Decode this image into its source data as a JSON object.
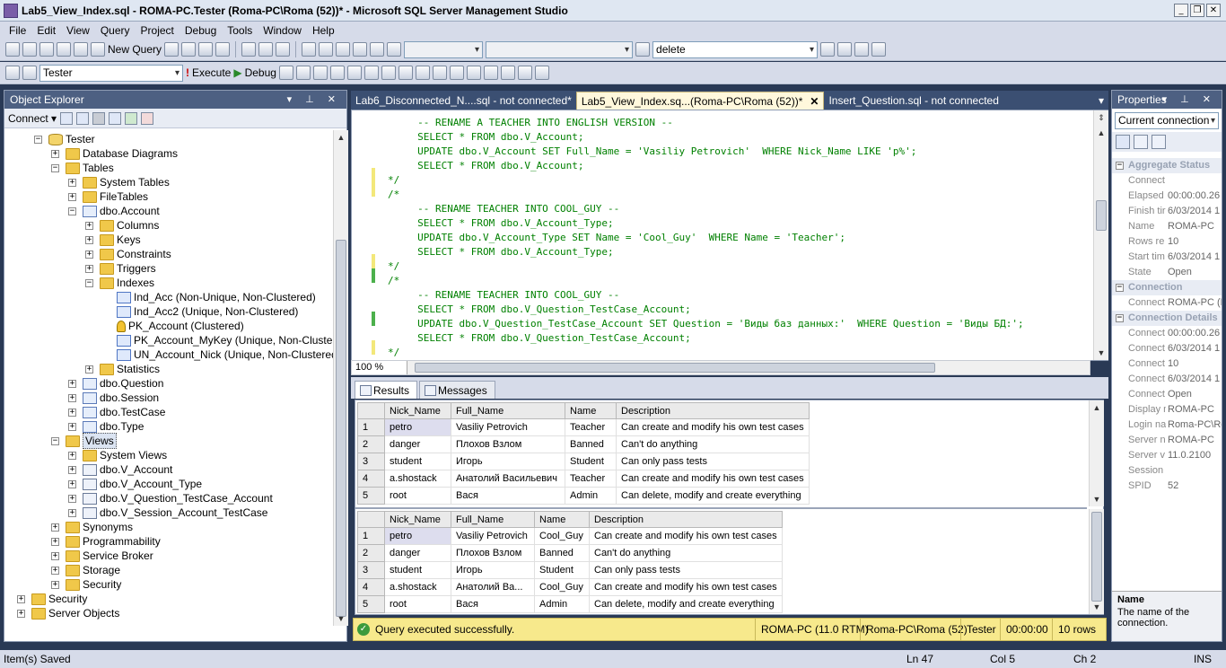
{
  "window": {
    "title": "Lab5_View_Index.sql - ROMA-PC.Tester (Roma-PC\\Roma (52))* - Microsoft SQL Server Management Studio",
    "buttons": [
      "_",
      "❐",
      "✕"
    ]
  },
  "menu": [
    "File",
    "Edit",
    "View",
    "Query",
    "Project",
    "Debug",
    "Tools",
    "Window",
    "Help"
  ],
  "toolbar1": {
    "new_query": "New Query",
    "search_combo": "delete"
  },
  "toolbar2": {
    "database": "Tester",
    "execute": "Execute",
    "debug": "Debug"
  },
  "object_explorer": {
    "title": "Object Explorer",
    "pin": "▾ ⊥ ✕",
    "connect": "Connect ▾",
    "tree": [
      {
        "label": "Tester",
        "icon": "database-icon",
        "depth": 2,
        "exp": "−"
      },
      {
        "label": "Database Diagrams",
        "icon": "folder-icon",
        "depth": 3,
        "exp": "+"
      },
      {
        "label": "Tables",
        "icon": "folder-icon",
        "depth": 3,
        "exp": "−"
      },
      {
        "label": "System Tables",
        "icon": "folder-icon",
        "depth": 4,
        "exp": "+"
      },
      {
        "label": "FileTables",
        "icon": "folder-icon",
        "depth": 4,
        "exp": "+"
      },
      {
        "label": "dbo.Account",
        "icon": "table-icon",
        "depth": 4,
        "exp": "−"
      },
      {
        "label": "Columns",
        "icon": "folder-icon",
        "depth": 5,
        "exp": "+"
      },
      {
        "label": "Keys",
        "icon": "folder-icon",
        "depth": 5,
        "exp": "+"
      },
      {
        "label": "Constraints",
        "icon": "folder-icon",
        "depth": 5,
        "exp": "+"
      },
      {
        "label": "Triggers",
        "icon": "folder-icon",
        "depth": 5,
        "exp": "+"
      },
      {
        "label": "Indexes",
        "icon": "folder-icon",
        "depth": 5,
        "exp": "−"
      },
      {
        "label": "Ind_Acc (Non-Unique, Non-Clustered)",
        "icon": "index-icon",
        "depth": 6,
        "exp": ""
      },
      {
        "label": "Ind_Acc2 (Unique, Non-Clustered)",
        "icon": "index-icon",
        "depth": 6,
        "exp": ""
      },
      {
        "label": "PK_Account (Clustered)",
        "icon": "primary-key-icon",
        "depth": 6,
        "exp": ""
      },
      {
        "label": "PK_Account_MyKey (Unique, Non-Clustere",
        "icon": "index-icon",
        "depth": 6,
        "exp": ""
      },
      {
        "label": "UN_Account_Nick (Unique, Non-Clustered)",
        "icon": "unique-index-icon",
        "depth": 6,
        "exp": ""
      },
      {
        "label": "Statistics",
        "icon": "folder-icon",
        "depth": 5,
        "exp": "+"
      },
      {
        "label": "dbo.Question",
        "icon": "table-icon",
        "depth": 4,
        "exp": "+"
      },
      {
        "label": "dbo.Session",
        "icon": "table-icon",
        "depth": 4,
        "exp": "+"
      },
      {
        "label": "dbo.TestCase",
        "icon": "table-icon",
        "depth": 4,
        "exp": "+"
      },
      {
        "label": "dbo.Type",
        "icon": "table-icon",
        "depth": 4,
        "exp": "+"
      },
      {
        "label": "Views",
        "icon": "folder-icon",
        "depth": 3,
        "exp": "−",
        "selected": true
      },
      {
        "label": "System Views",
        "icon": "folder-icon",
        "depth": 4,
        "exp": "+"
      },
      {
        "label": "dbo.V_Account",
        "icon": "view-icon",
        "depth": 4,
        "exp": "+"
      },
      {
        "label": "dbo.V_Account_Type",
        "icon": "view-icon",
        "depth": 4,
        "exp": "+"
      },
      {
        "label": "dbo.V_Question_TestCase_Account",
        "icon": "view-icon",
        "depth": 4,
        "exp": "+"
      },
      {
        "label": "dbo.V_Session_Account_TestCase",
        "icon": "view-icon",
        "depth": 4,
        "exp": "+"
      },
      {
        "label": "Synonyms",
        "icon": "folder-icon",
        "depth": 3,
        "exp": "+"
      },
      {
        "label": "Programmability",
        "icon": "folder-icon",
        "depth": 3,
        "exp": "+"
      },
      {
        "label": "Service Broker",
        "icon": "folder-icon",
        "depth": 3,
        "exp": "+"
      },
      {
        "label": "Storage",
        "icon": "folder-icon",
        "depth": 3,
        "exp": "+"
      },
      {
        "label": "Security",
        "icon": "folder-icon",
        "depth": 3,
        "exp": "+"
      },
      {
        "label": "Security",
        "icon": "folder-icon",
        "depth": 1,
        "exp": "+"
      },
      {
        "label": "Server Objects",
        "icon": "folder-icon",
        "depth": 1,
        "exp": "+"
      }
    ]
  },
  "doc_tabs": [
    {
      "label": "Lab6_Disconnected_N....sql - not connected*",
      "active": false
    },
    {
      "label": "Lab5_View_Index.sq...(Roma-PC\\Roma (52))*",
      "active": true,
      "close": "✕"
    },
    {
      "label": "Insert_Question.sql - not connected",
      "active": false
    }
  ],
  "editor": {
    "zoom": "100 %",
    "lines": [
      "     -- RENAME A TEACHER INTO ENGLISH VERSION --",
      "     SELECT * FROM dbo.V_Account;",
      "     UPDATE dbo.V_Account SET Full_Name = 'Vasiliy Petrovich'  WHERE Nick_Name LIKE 'p%';",
      "     SELECT * FROM dbo.V_Account;",
      "*/",
      "/*",
      "     -- RENAME TEACHER INTO COOL_GUY --",
      "     SELECT * FROM dbo.V_Account_Type;",
      "     UPDATE dbo.V_Account_Type SET Name = 'Cool_Guy'  WHERE Name = 'Teacher';",
      "     SELECT * FROM dbo.V_Account_Type;",
      "*/",
      "/*",
      "     -- RENAME TEACHER INTO COOL_GUY --",
      "     SELECT * FROM dbo.V_Question_TestCase_Account;",
      "     UPDATE dbo.V_Question_TestCase_Account SET Question = 'Виды баз данных:'  WHERE Question = 'Виды БД:';",
      "     SELECT * FROM dbo.V_Question_TestCase_Account;",
      "*/"
    ]
  },
  "result_tabs": [
    "Results",
    "Messages"
  ],
  "grid1": {
    "columns": [
      "Nick_Name",
      "Full_Name",
      "Name",
      "Description"
    ],
    "rows": [
      [
        "1",
        "petro",
        "Vasiliy Petrovich",
        "Teacher",
        "Can create and modify his own test cases"
      ],
      [
        "2",
        "danger",
        "Плохов Взлом",
        "Banned",
        "Can't do anything"
      ],
      [
        "3",
        "student",
        "Игорь",
        "Student",
        "Can only pass tests"
      ],
      [
        "4",
        "a.shostack",
        "Анатолий Васильевич",
        "Teacher",
        "Can create and modify his own test cases"
      ],
      [
        "5",
        "root",
        "Вася",
        "Admin",
        "Can delete, modify and create everything"
      ]
    ]
  },
  "grid2": {
    "columns": [
      "Nick_Name",
      "Full_Name",
      "Name",
      "Description"
    ],
    "rows": [
      [
        "1",
        "petro",
        "Vasiliy Petrovich",
        "Cool_Guy",
        "Can create and modify his own test cases"
      ],
      [
        "2",
        "danger",
        "Плохов Взлом",
        "Banned",
        "Can't do anything"
      ],
      [
        "3",
        "student",
        "Игорь",
        "Student",
        "Can only pass tests"
      ],
      [
        "4",
        "a.shostack",
        "Анатолий Ва...",
        "Cool_Guy",
        "Can create and modify his own test cases"
      ],
      [
        "5",
        "root",
        "Вася",
        "Admin",
        "Can delete, modify and create everything"
      ]
    ]
  },
  "query_status": {
    "message": "Query executed successfully.",
    "server": "ROMA-PC (11.0 RTM)",
    "user": "Roma-PC\\Roma (52)",
    "database": "Tester",
    "time": "00:00:00",
    "rows": "10 rows"
  },
  "properties": {
    "title": "Properties",
    "object": "Current connection",
    "categories": [
      {
        "name": "Aggregate Status",
        "rows": [
          [
            "Connect",
            ""
          ],
          [
            "Elapsed",
            "00:00:00.26"
          ],
          [
            "Finish tir",
            "6/03/2014 1"
          ],
          [
            "Name",
            "ROMA-PC"
          ],
          [
            "Rows re",
            "10"
          ],
          [
            "Start tim",
            "6/03/2014 1"
          ],
          [
            "State",
            "Open"
          ]
        ]
      },
      {
        "name": "Connection",
        "rows": [
          [
            "Connect",
            "ROMA-PC (F"
          ]
        ]
      },
      {
        "name": "Connection Details",
        "rows": [
          [
            "Connect",
            "00:00:00.26"
          ],
          [
            "Connect",
            "6/03/2014 1"
          ],
          [
            "Connect",
            "10"
          ],
          [
            "Connect",
            "6/03/2014 1"
          ],
          [
            "Connect",
            "Open"
          ],
          [
            "Display n",
            "ROMA-PC"
          ],
          [
            "Login na",
            "Roma-PC\\Ro"
          ],
          [
            "Server n",
            "ROMA-PC"
          ],
          [
            "Server v",
            "11.0.2100"
          ],
          [
            "Session",
            ""
          ],
          [
            "SPID",
            "52"
          ]
        ]
      }
    ],
    "desc_title": "Name",
    "desc_text": "The name of the connection."
  },
  "statusbar": {
    "left": "Item(s) Saved",
    "ln": "Ln 47",
    "col": "Col 5",
    "ch": "Ch 2",
    "mode": "INS"
  }
}
